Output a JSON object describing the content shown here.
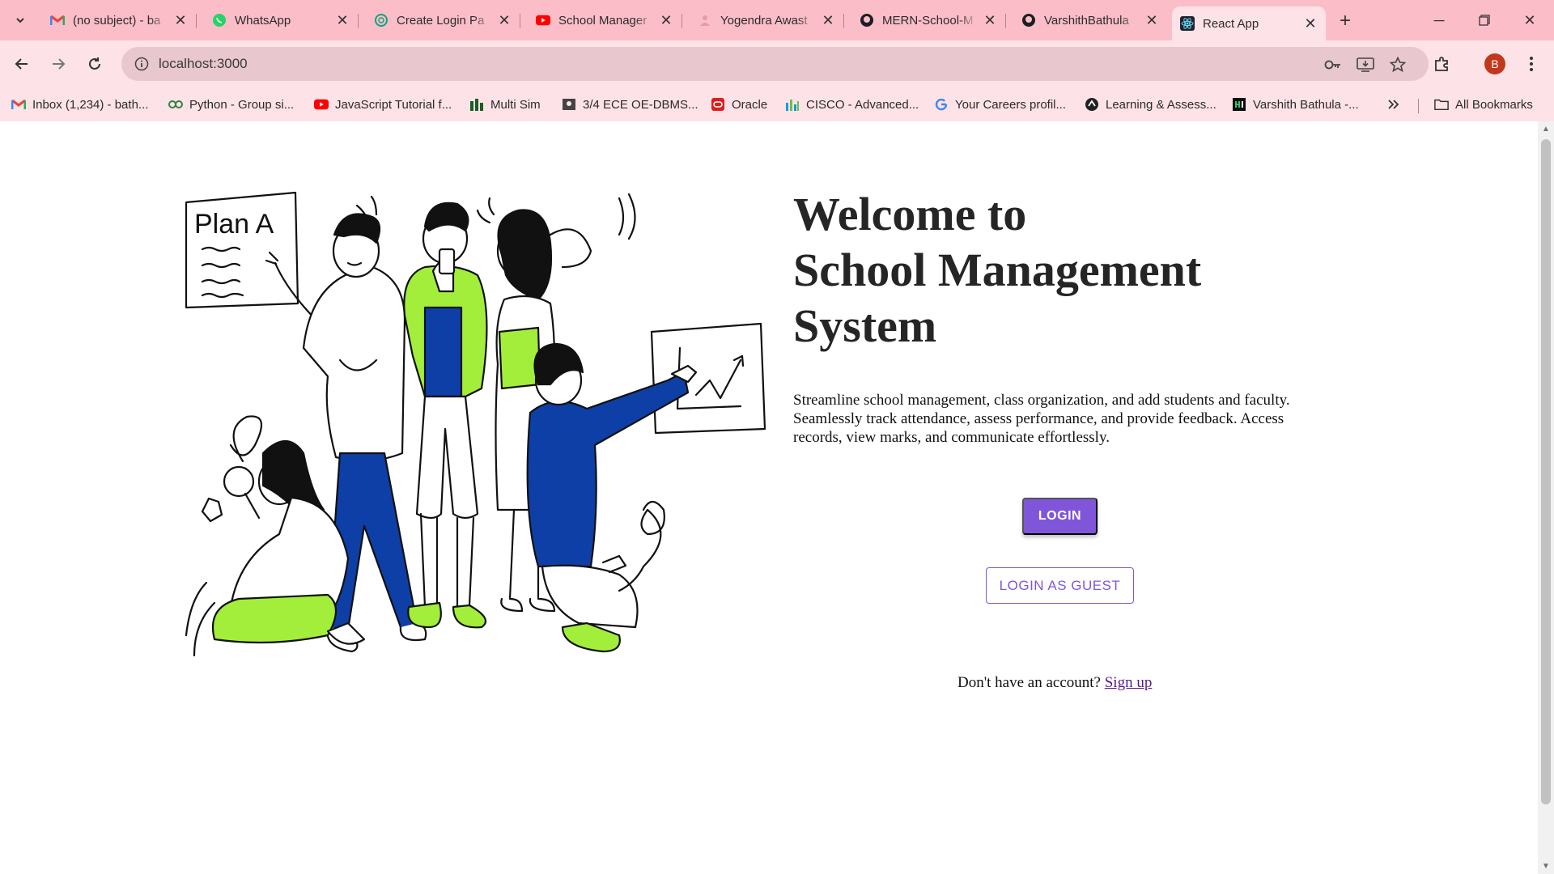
{
  "browser": {
    "tabs": [
      {
        "title": "(no subject) - ba",
        "icon": "gmail-icon"
      },
      {
        "title": "WhatsApp",
        "icon": "whatsapp-icon"
      },
      {
        "title": "Create Login Pa",
        "icon": "chatgpt-icon"
      },
      {
        "title": "School Manager",
        "icon": "youtube-icon"
      },
      {
        "title": "Yogendra Awast",
        "icon": "profile-icon"
      },
      {
        "title": "MERN-School-M",
        "icon": "github-icon"
      },
      {
        "title": "VarshithBathula",
        "icon": "github-icon"
      },
      {
        "title": "React App",
        "icon": "react-icon",
        "active": true
      }
    ],
    "url": "localhost:3000",
    "profile_initial": "B",
    "bookmarks": [
      {
        "label": "Inbox (1,234) - bath...",
        "icon": "gmail-icon"
      },
      {
        "label": "Python - Group si...",
        "icon": "python-icon"
      },
      {
        "label": "JavaScript Tutorial f...",
        "icon": "youtube-icon"
      },
      {
        "label": "Multi Sim",
        "icon": "multisim-icon"
      },
      {
        "label": "3/4 ECE OE-DBMS...",
        "icon": "classroom-icon"
      },
      {
        "label": "Oracle",
        "icon": "oracle-icon"
      },
      {
        "label": "CISCO - Advanced...",
        "icon": "cisco-icon"
      },
      {
        "label": "Your Careers profil...",
        "icon": "google-icon"
      },
      {
        "label": "Learning & Assess...",
        "icon": "learning-icon"
      },
      {
        "label": "Varshith Bathula -...",
        "icon": "hackerrank-icon"
      }
    ],
    "all_bookmarks_label": "All Bookmarks"
  },
  "page": {
    "headline_line1": "Welcome to",
    "headline_line2": "School Management",
    "headline_line3": "System",
    "description": "Streamline school management, class organization, and add students and faculty. Seamlessly track attendance, assess performance, and provide feedback. Access records, view marks, and communicate effortlessly.",
    "login_label": "LOGIN",
    "guest_label": "LOGIN AS GUEST",
    "signup_prompt": "Don't have an account?",
    "signup_link": "Sign up",
    "illustration_text": "Plan A"
  },
  "colors": {
    "accent": "#7f56da",
    "tab_strip": "#fbbec9",
    "toolbar": "#fde2e7",
    "illustration_blue": "#0d3fa6",
    "illustration_green": "#a3ee3b"
  }
}
